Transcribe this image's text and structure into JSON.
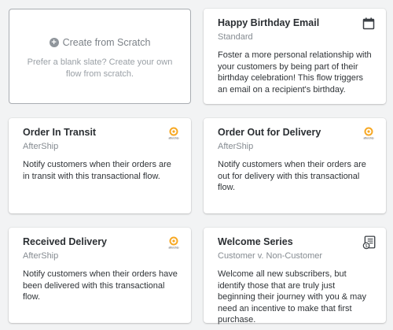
{
  "scratch": {
    "title": "Create from Scratch",
    "description": "Prefer a blank slate? Create your own flow from scratch."
  },
  "cards": [
    {
      "title": "Happy Birthday Email",
      "subtitle": "Standard",
      "description": "Foster a more personal relationship with your customers by being part of their birthday celebration! This flow triggers an email on a recipient's birthday.",
      "icon": "calendar-icon"
    },
    {
      "title": "Order In Transit",
      "subtitle": "AfterShip",
      "description": "Notify customers when their orders are in transit with this transactional flow.",
      "icon": "aftership-logo-icon",
      "icon_label": "aftership"
    },
    {
      "title": "Order Out for Delivery",
      "subtitle": "AfterShip",
      "description": "Notify customers when their orders are out for delivery with this transactional flow.",
      "icon": "aftership-logo-icon",
      "icon_label": "aftership"
    },
    {
      "title": "Received Delivery",
      "subtitle": "AfterShip",
      "description": "Notify customers when their orders have been delivered with this transactional flow.",
      "icon": "aftership-logo-icon",
      "icon_label": "aftership"
    },
    {
      "title": "Welcome Series",
      "subtitle": "Customer v. Non-Customer",
      "description": "Welcome all new subscribers, but identify those that are truly just beginning their journey with you & may need an incentive to make that first purchase.",
      "icon": "document-dollar-icon"
    }
  ],
  "colors": {
    "aftership_orange": "#f7a823",
    "icon_dark": "#3a3f44"
  }
}
